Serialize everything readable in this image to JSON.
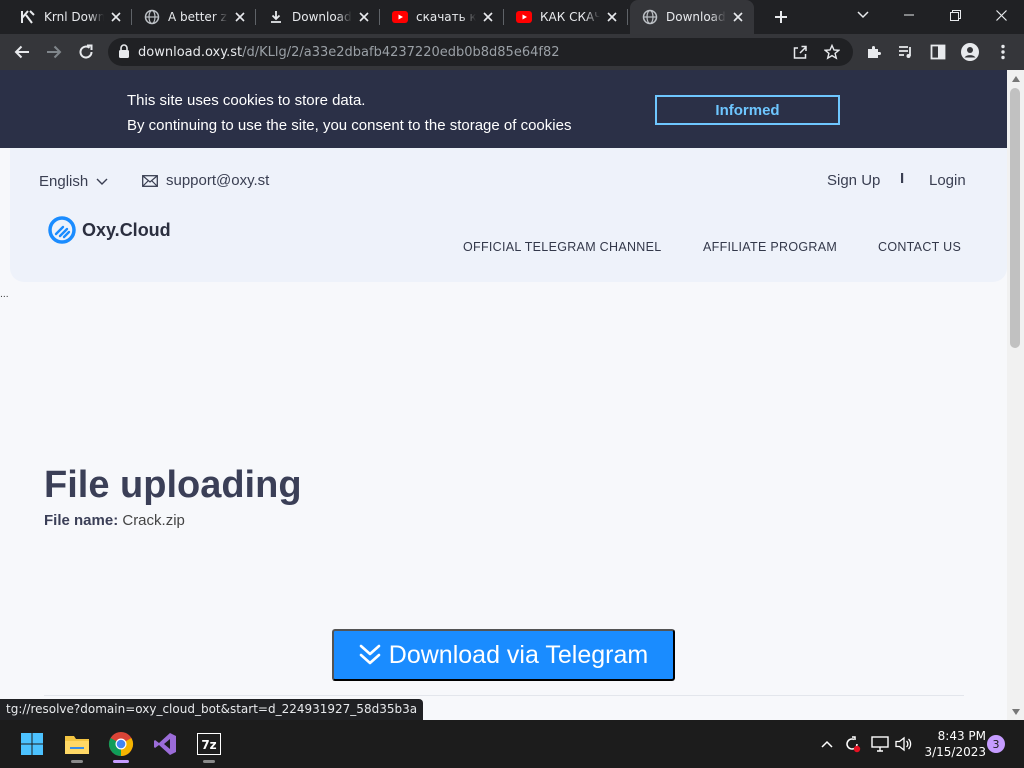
{
  "tabs": [
    {
      "title": "Krnl Downloads",
      "icon": "krnl-logo-icon",
      "active": false
    },
    {
      "title": "A better zip",
      "icon": "globe-icon",
      "active": false
    },
    {
      "title": "Downloads",
      "icon": "download-icon",
      "active": false
    },
    {
      "title": "скачать крякнутый",
      "icon": "youtube-icon",
      "active": false
    },
    {
      "title": "КАК СКАЧАТЬ",
      "icon": "youtube-icon",
      "active": false
    },
    {
      "title": "Download",
      "icon": "globe-icon",
      "active": true
    }
  ],
  "address": {
    "host": "download.oxy.st",
    "path": "/d/KLlg/2/a33e2dbafb4237220edb0b8d85e64f82"
  },
  "cookie_banner": {
    "line1": "This site uses cookies to store data.",
    "line2": "By continuing to use the site, you consent to the storage of cookies",
    "button": "Informed"
  },
  "header": {
    "language": "English",
    "support_email": "support@oxy.st",
    "signup": "Sign Up",
    "separator": "I",
    "login": "Login",
    "logo_text": "Oxy.Cloud",
    "nav": [
      "OFFICIAL TELEGRAM CHANNEL",
      "AFFILIATE PROGRAM",
      "CONTACT US"
    ]
  },
  "main": {
    "title": "File uploading",
    "file_label": "File name:",
    "file_name": "Crack.zip",
    "download_button": "Download via Telegram",
    "ellipsis": "..."
  },
  "status_url": "tg://resolve?domain=oxy_cloud_bot&start=d_224931927_58d35b3a",
  "taskbar": {
    "time": "8:43 PM",
    "date": "3/15/2023",
    "notifications": "3"
  },
  "colors": {
    "cookie_bg": "#2b3047",
    "accent_blue": "#1a8cff",
    "outline_blue": "#6ec6ff",
    "title_text": "#3b3f57"
  }
}
